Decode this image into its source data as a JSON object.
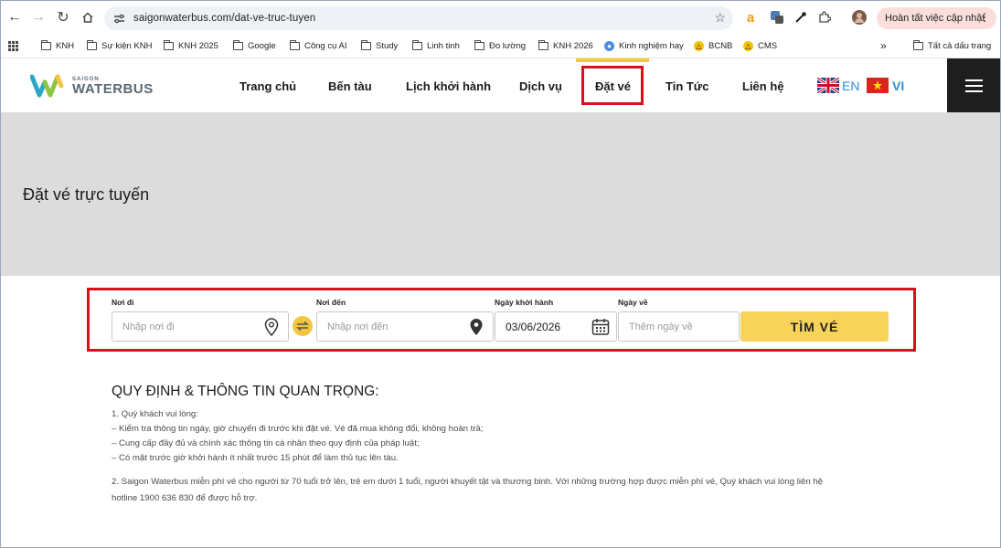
{
  "browser": {
    "url": "saigonwaterbus.com/dat-ve-truc-tuyen",
    "update_button": "Hoàn tất việc cập nhật",
    "bookmarks": [
      {
        "label": "KNH",
        "type": "folder"
      },
      {
        "label": "Sự kiện KNH",
        "type": "folder"
      },
      {
        "label": "KNH 2025",
        "type": "folder"
      },
      {
        "label": "Google",
        "type": "folder"
      },
      {
        "label": "Công cụ AI",
        "type": "folder"
      },
      {
        "label": "Study",
        "type": "folder"
      },
      {
        "label": "Linh tinh",
        "type": "folder"
      },
      {
        "label": "Đo lường",
        "type": "folder"
      },
      {
        "label": "KNH 2026",
        "type": "folder"
      },
      {
        "label": "Kinh nghiệm hay",
        "type": "site"
      },
      {
        "label": "BCNB",
        "type": "site"
      },
      {
        "label": "CMS",
        "type": "site"
      }
    ],
    "more_bookmarks": "»",
    "all_bookmarks": "Tất cả dấu trang"
  },
  "site": {
    "logo_small": "SAIGON",
    "logo_big": "WATERBUS",
    "menu": [
      {
        "label": "Trang chủ"
      },
      {
        "label": "Bến tàu"
      },
      {
        "label": "Lịch khởi hành"
      },
      {
        "label": "Dịch vụ"
      },
      {
        "label": "Đặt vé"
      },
      {
        "label": "Tin Tức"
      },
      {
        "label": "Liên hệ"
      }
    ],
    "lang_en": "EN",
    "lang_vi": "VI",
    "colors": {
      "accent": "#f4c542",
      "highlight": "#d8101e",
      "dark": "#1e1e1e",
      "lang_blue": "#2f8fd6"
    }
  },
  "banner": {
    "title": "Đặt vé trực tuyến"
  },
  "form": {
    "from_label": "Nơi đi",
    "from_placeholder": "Nhập nơi đi",
    "to_label": "Nơi đến",
    "to_placeholder": "Nhập nơi đến",
    "depart_label": "Ngày khởi hành",
    "depart_value": "03/06/2026",
    "return_label": "Ngày về",
    "return_placeholder": "Thêm ngày về",
    "search_button": "TÌM VÉ"
  },
  "info": {
    "title": "QUY ĐỊNH & THÔNG TIN QUAN TRỌNG:",
    "lines": [
      "1. Quý khách vui lòng:",
      "– Kiểm tra thông tin ngày, giờ chuyến đi trước khi đặt vé. Vé đã mua không đổi, không hoàn trả;",
      "– Cung cấp đầy đủ và chính xác thông tin cá nhân theo quy định của pháp luật;",
      "– Có mặt trước giờ khởi hành ít nhất trước 15 phút để làm thủ tục lên tàu.",
      "2. Saigon Waterbus miễn phí vé cho người từ 70 tuổi trở lên, trẻ em dưới 1 tuổi, người khuyết tật và thương binh. Với những trường hợp được miễn phí vé, Quý khách vui lòng liên hệ",
      "hotline 1900 636 830 để được hỗ trợ."
    ]
  }
}
